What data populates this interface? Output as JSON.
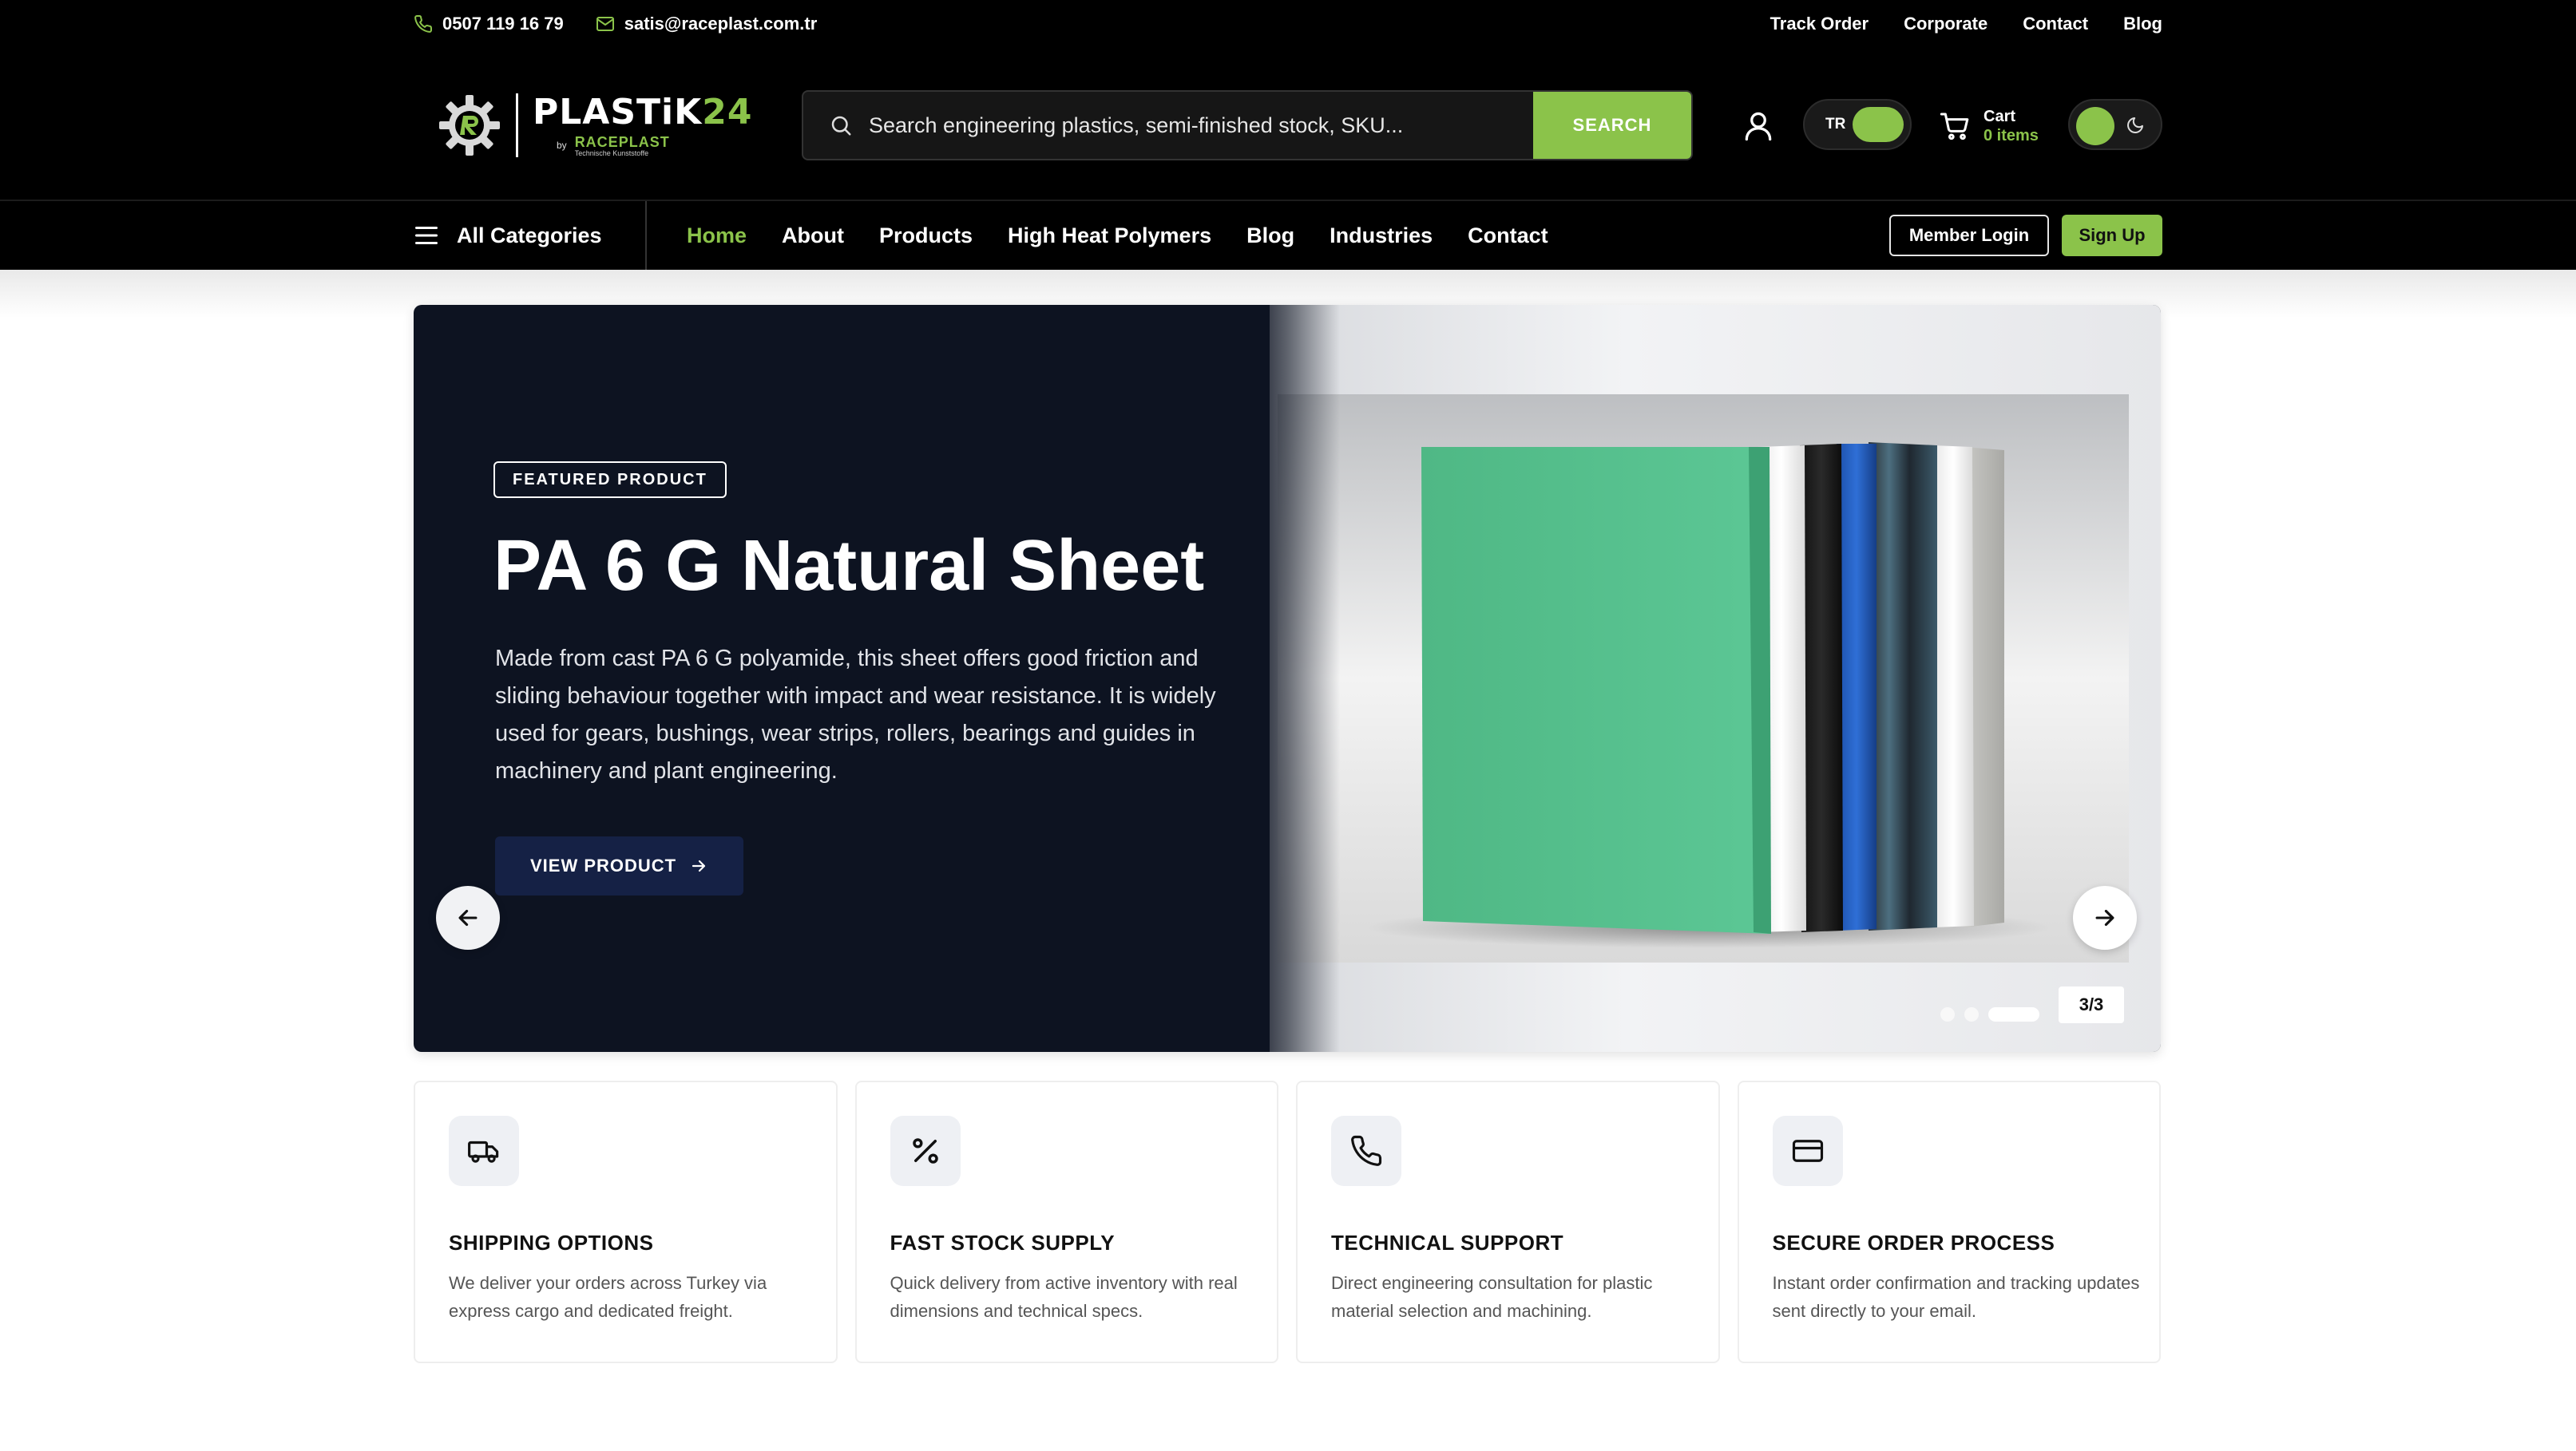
{
  "topbar": {
    "phone": "0507 119 16 79",
    "email": "satis@raceplast.com.tr",
    "links": [
      "Track Order",
      "Corporate",
      "Contact",
      "Blog"
    ]
  },
  "header": {
    "logo": {
      "main": "PLASTiK",
      "num": "24",
      "by": "by",
      "brand": "RACEPLAST",
      "tagline": "Technische Kunststoffe"
    },
    "search": {
      "placeholder": "Search engineering plastics, semi-finished stock, SKU...",
      "button": "SEARCH"
    },
    "lang": "TR",
    "cart": {
      "label": "Cart",
      "count": "0 items"
    }
  },
  "nav": {
    "all_categories": "All Categories",
    "links": [
      "Home",
      "About",
      "Products",
      "High Heat Polymers",
      "Blog",
      "Industries",
      "Contact"
    ],
    "member_login": "Member Login",
    "sign_up": "Sign Up"
  },
  "hero": {
    "badge": "FEATURED PRODUCT",
    "title": "PA 6 G Natural Sheet",
    "description": "Made from cast PA 6 G polyamide, this sheet offers good friction and sliding behaviour together with impact and wear resistance. It is widely used for gears, bushings, wear strips, rollers, bearings and guides in machinery and plant engineering.",
    "button": "VIEW PRODUCT",
    "counter": "3/3",
    "slide_current": 3,
    "slide_total": 3
  },
  "features": [
    {
      "icon": "truck-icon",
      "title": "SHIPPING OPTIONS",
      "desc": "We deliver your orders across Turkey via express cargo and dedicated freight."
    },
    {
      "icon": "percent-icon",
      "title": "FAST STOCK SUPPLY",
      "desc": "Quick delivery from active inventory with real dimensions and technical specs."
    },
    {
      "icon": "phone-icon",
      "title": "TECHNICAL SUPPORT",
      "desc": "Direct engineering consultation for plastic material selection and machining."
    },
    {
      "icon": "credit-card-icon",
      "title": "SECURE ORDER PROCESS",
      "desc": "Instant order confirmation and tracking updates sent directly to your email."
    }
  ],
  "colors": {
    "accent": "#8bc34a",
    "hero_bg": "#0d1321",
    "button_dark": "#152145",
    "topbar_bg": "#000000"
  }
}
